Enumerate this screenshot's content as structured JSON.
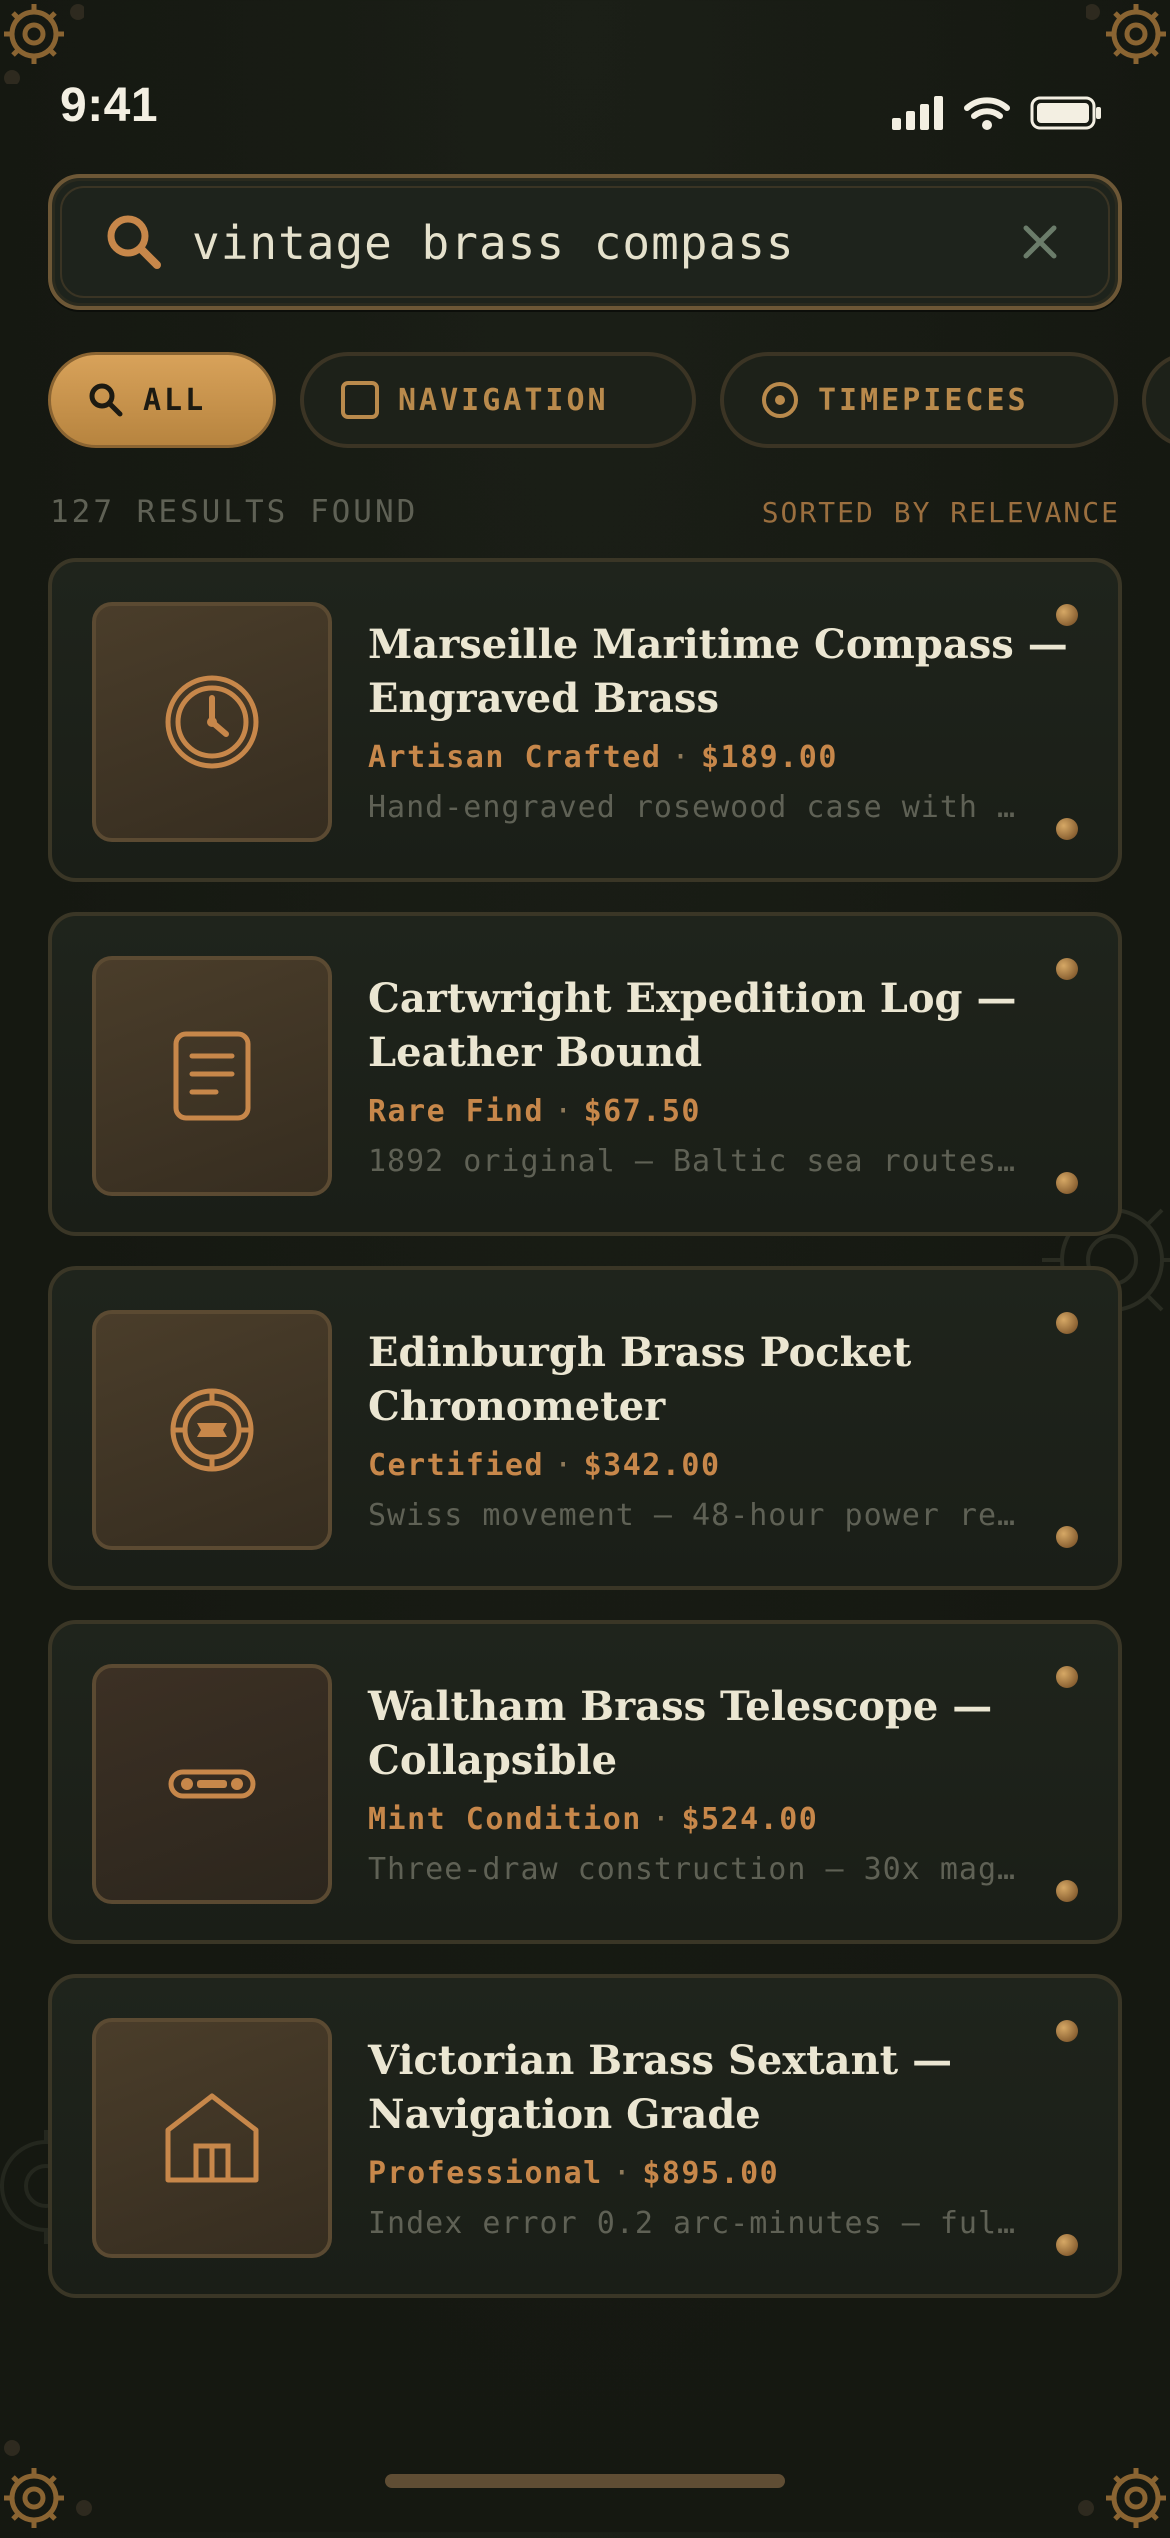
{
  "status": {
    "time": "9:41"
  },
  "search": {
    "query": "vintage brass compass"
  },
  "filters": [
    {
      "label": "ALL",
      "icon": "search-icon",
      "active": true
    },
    {
      "label": "NAVIGATION",
      "icon": "square-icon",
      "active": false
    },
    {
      "label": "TIMEPIECES",
      "icon": "target-icon",
      "active": false
    }
  ],
  "results": {
    "count_text": "127 RESULTS FOUND",
    "sort_text": "SORTED BY RELEVANCE"
  },
  "products": [
    {
      "title": "Marseille Maritime Compass — Engraved Brass",
      "tag": "Artisan Crafted",
      "price": "$189.00",
      "desc": "Hand-engraved rosewood case with …",
      "icon": "clock-icon"
    },
    {
      "title": "Cartwright Expedition Log — Leather Bound",
      "tag": "Rare Find",
      "price": "$67.50",
      "desc": "1892 original — Baltic sea routes…",
      "icon": "document-icon"
    },
    {
      "title": "Edinburgh Brass Pocket Chronometer",
      "tag": "Certified",
      "price": "$342.00",
      "desc": "Swiss movement — 48-hour power re…",
      "icon": "chronometer-icon"
    },
    {
      "title": "Waltham Brass Telescope — Collapsible",
      "tag": "Mint Condition",
      "price": "$524.00",
      "desc": "Three-draw construction — 30x mag…",
      "icon": "telescope-icon"
    },
    {
      "title": "Victorian Brass Sextant — Navigation Grade",
      "tag": "Professional",
      "price": "$895.00",
      "desc": "Index error 0.2 arc-minutes — ful…",
      "icon": "house-icon"
    }
  ],
  "colors": {
    "accent": "#c7874a",
    "background": "#161912",
    "card": "#1f241c",
    "chip_active": "#d8a25a"
  }
}
